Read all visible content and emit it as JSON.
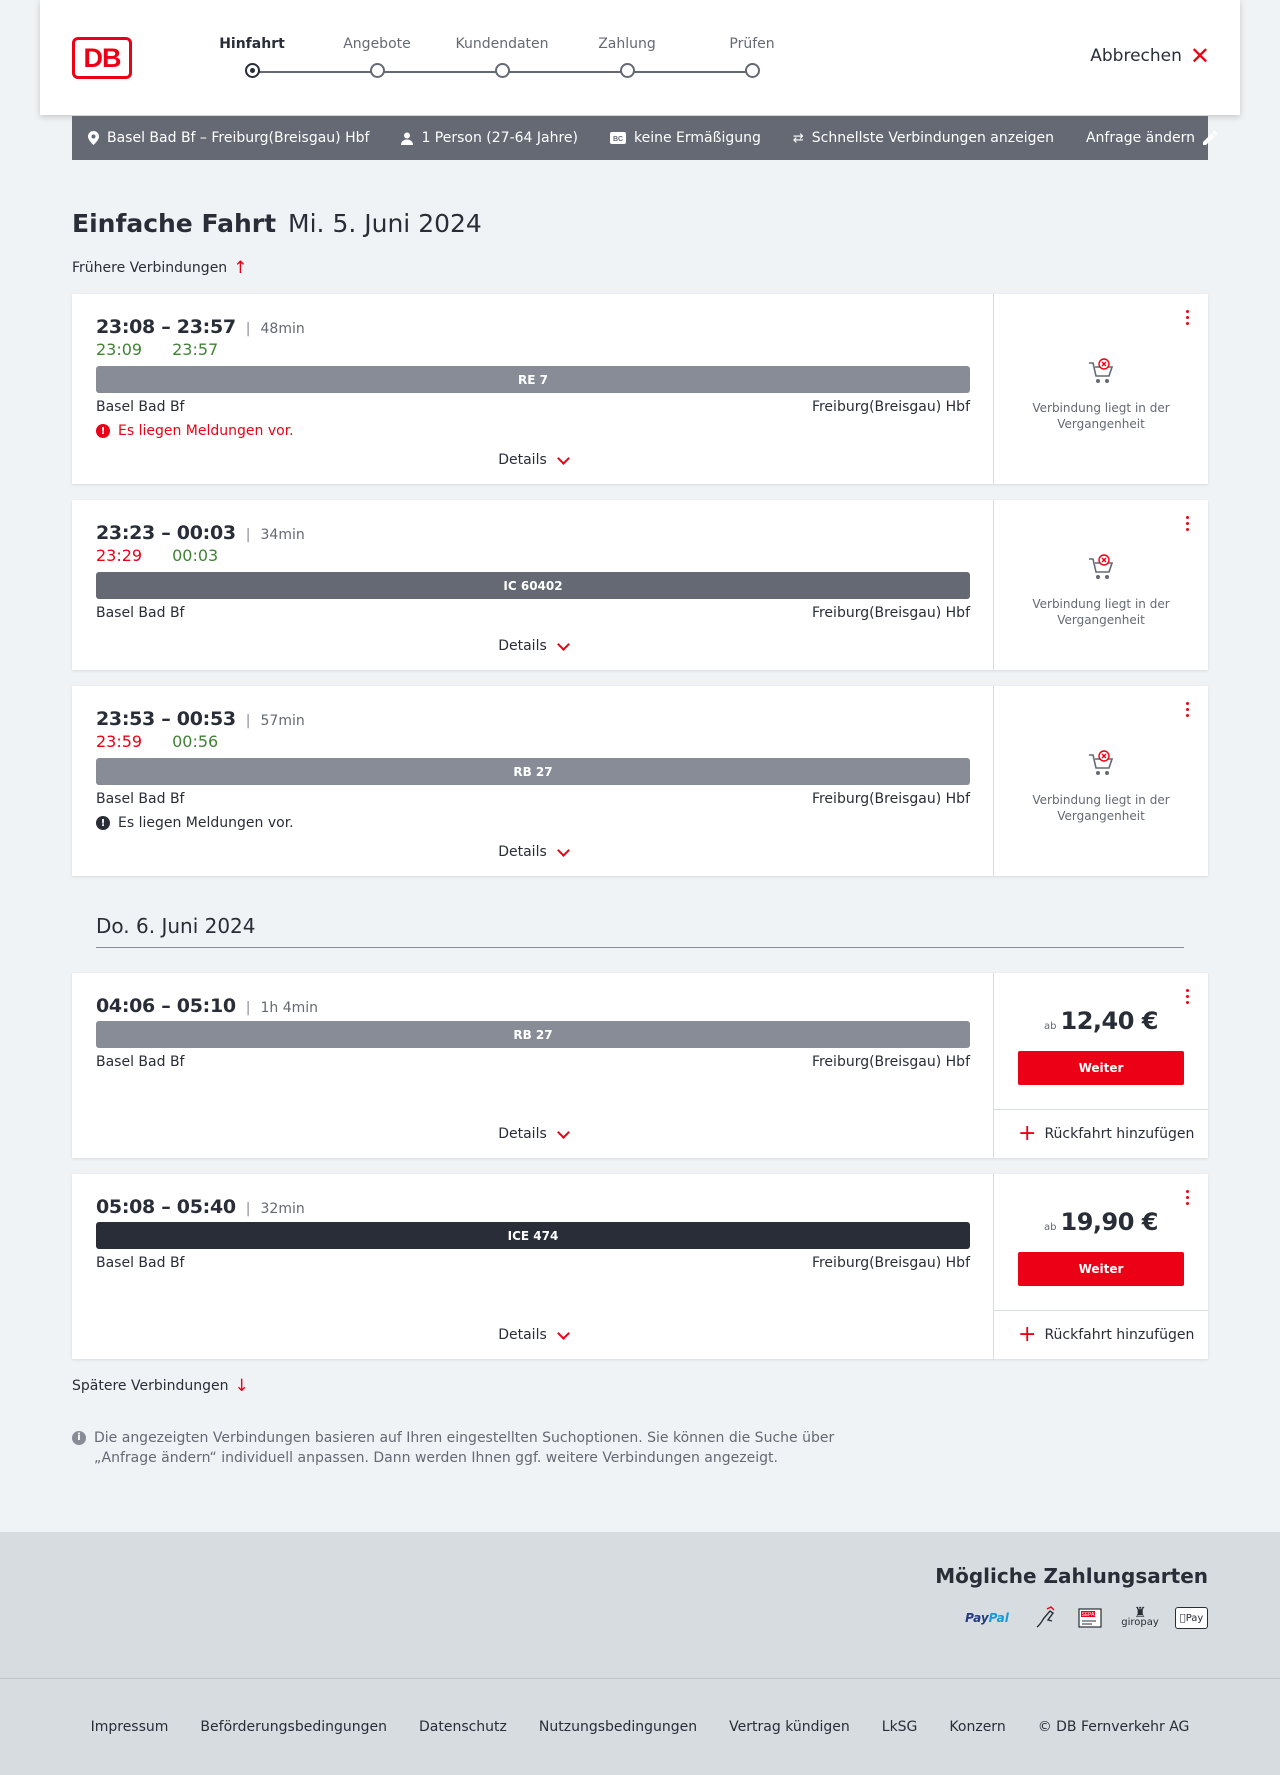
{
  "header": {
    "logo": "DB",
    "steps": [
      {
        "label": "Hinfahrt",
        "active": true
      },
      {
        "label": "Angebote",
        "active": false
      },
      {
        "label": "Kundendaten",
        "active": false
      },
      {
        "label": "Zahlung",
        "active": false
      },
      {
        "label": "Prüfen",
        "active": false
      }
    ],
    "cancel_label": "Abbrechen"
  },
  "summary": {
    "route": "Basel Bad Bf – Freiburg(Breisgau) Hbf",
    "passengers": "1 Person (27-64 Jahre)",
    "discount_badge": "BC",
    "discount": "keine Ermäßigung",
    "fastest": "Schnellste Verbindungen anzeigen",
    "edit": "Anfrage ändern"
  },
  "page": {
    "title": "Einfache Fahrt",
    "date": "Mi. 5. Juni 2024",
    "earlier": "Frühere Verbindungen",
    "later": "Spätere Verbindungen",
    "day2": "Do. 6. Juni 2024",
    "details_label": "Details",
    "past_text_1": "Verbindung liegt in der",
    "past_text_2": "Vergangenheit",
    "ab": "ab",
    "weiter": "Weiter",
    "return_label": "Rückfahrt hinzufügen",
    "info": "Die angezeigten Verbindungen basieren auf Ihren eingestellten Suchoptionen. Sie können die Suche über „Anfrage ändern“ individuell anpassen. Dann werden Ihnen ggf. weitere Verbindungen angezeigt."
  },
  "connections": [
    {
      "times": "23:08 – 23:57",
      "duration": "48min",
      "rt_dep": "23:09",
      "rt_arr": "23:57",
      "train": "RE 7",
      "train_color": "#878c96",
      "from": "Basel Bad Bf",
      "to": "Freiburg(Breisgau) Hbf",
      "message": "Es liegen Meldungen vor."
    },
    {
      "times": "23:23 – 00:03",
      "duration": "34min",
      "rt_dep": "23:29",
      "rt_arr": "00:03",
      "train": "IC 60402",
      "train_color": "#646973",
      "from": "Basel Bad Bf",
      "to": "Freiburg(Breisgau) Hbf"
    },
    {
      "times": "23:53 – 00:53",
      "duration": "57min",
      "rt_dep": "23:59",
      "rt_arr": "00:56",
      "train": "RB 27",
      "train_color": "#878c96",
      "from": "Basel Bad Bf",
      "to": "Freiburg(Breisgau) Hbf",
      "message": "Es liegen Meldungen vor."
    },
    {
      "times": "04:06 – 05:10",
      "duration": "1h 4min",
      "train": "RB 27",
      "train_color": "#878c96",
      "from": "Basel Bad Bf",
      "to": "Freiburg(Breisgau) Hbf",
      "price": "12,40 €"
    },
    {
      "times": "05:08 – 05:40",
      "duration": "32min",
      "train": "ICE 474",
      "train_color": "#282d37",
      "from": "Basel Bad Bf",
      "to": "Freiburg(Breisgau) Hbf",
      "price": "19,90 €"
    }
  ],
  "footer": {
    "pay_title": "Mögliche Zahlungsarten",
    "pay_methods": {
      "paypal_a": "Pay",
      "paypal_b": "Pal",
      "sepa": "SEPA",
      "giropay": "giropay",
      "applepay": "Pay"
    },
    "links": [
      "Impressum",
      "Beförderungsbedingungen",
      "Datenschutz",
      "Nutzungsbedingungen",
      "Vertrag kündigen",
      "LkSG",
      "Konzern",
      "© DB Fernverkehr AG"
    ]
  },
  "colors": {
    "brand": "#ec0016",
    "ok": "#408335",
    "delay": "#ec0016"
  }
}
